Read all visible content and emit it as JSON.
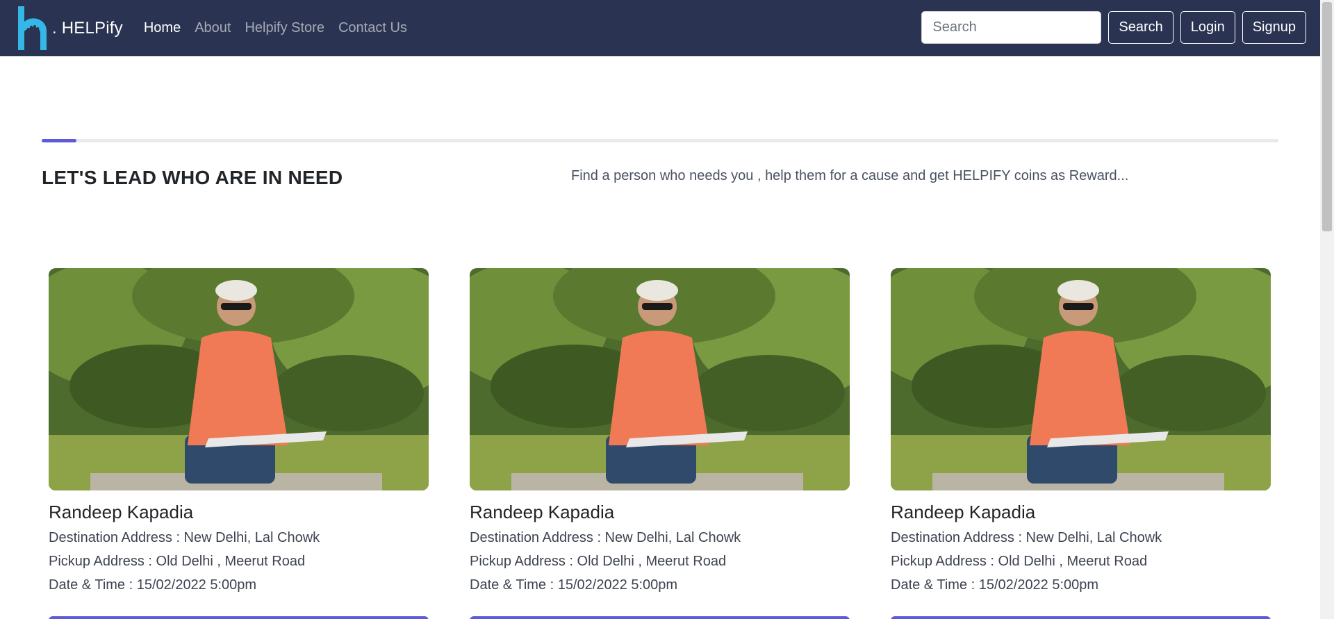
{
  "nav": {
    "brand": ". HELPify",
    "links": [
      {
        "label": "Home",
        "active": true
      },
      {
        "label": "About",
        "active": false
      },
      {
        "label": "Helpify Store",
        "active": false
      },
      {
        "label": "Contact Us",
        "active": false
      }
    ],
    "search_placeholder": "Search",
    "search_button": "Search",
    "login": "Login",
    "signup": "Signup"
  },
  "hero": {
    "title": "LET'S LEAD WHO ARE IN NEED",
    "subtitle": "Find a person who needs you , help them for a cause and get HELPIFY coins as Reward..."
  },
  "cards": [
    {
      "name": "Randeep Kapadia",
      "destination": "Destination Address : New Delhi, Lal Chowk",
      "pickup": "Pickup Address : Old Delhi , Meerut Road",
      "datetime": "Date & Time : 15/02/2022  5:00pm"
    },
    {
      "name": "Randeep Kapadia",
      "destination": "Destination Address : New Delhi, Lal Chowk",
      "pickup": "Pickup Address : Old Delhi , Meerut Road",
      "datetime": "Date & Time : 15/02/2022  5:00pm"
    },
    {
      "name": "Randeep Kapadia",
      "destination": "Destination Address : New Delhi, Lal Chowk",
      "pickup": "Pickup Address : Old Delhi , Meerut Road",
      "datetime": "Date & Time : 15/02/2022  5:00pm"
    }
  ],
  "colors": {
    "navbar": "#2a3452",
    "accent": "#5f5ad8",
    "logo": "#35b8e8"
  },
  "progress_fraction": 0.028
}
